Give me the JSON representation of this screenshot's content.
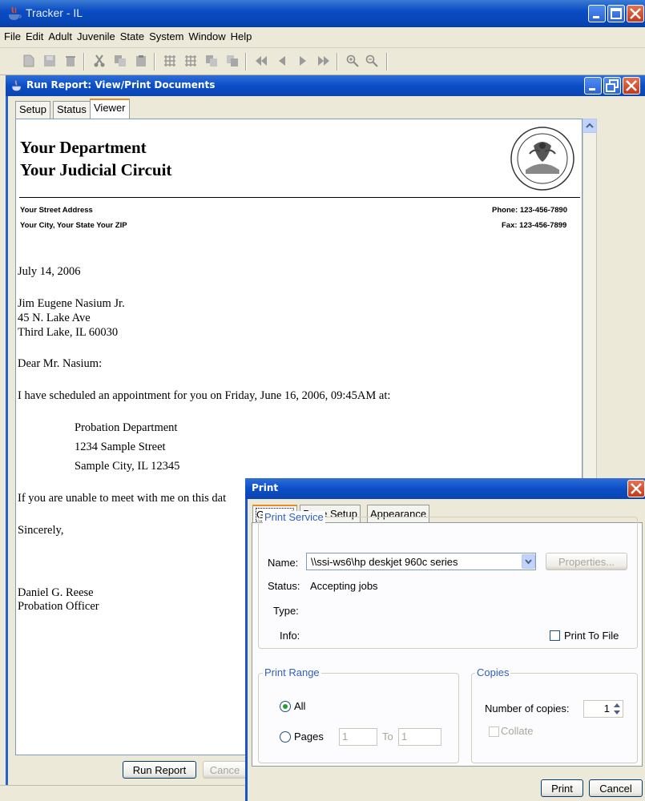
{
  "app": {
    "title": "Tracker - IL"
  },
  "menu": [
    "File",
    "Edit",
    "Adult",
    "Juvenile",
    "State",
    "System",
    "Window",
    "Help"
  ],
  "inner_window": {
    "title": "Run Report: View/Print Documents"
  },
  "tabs": [
    "Setup",
    "Status",
    "Viewer"
  ],
  "document": {
    "dept": "Your Department",
    "circuit": "Your Judicial Circuit",
    "address1": "Your Street Address",
    "address2": "Your City, Your State Your ZIP",
    "phone": "Phone: 123-456-7890",
    "fax": "Fax: 123-456-7899",
    "date": "July 14, 2006",
    "to_name": "Jim Eugene Nasium Jr.",
    "to_street": "45 N. Lake Ave",
    "to_city": "Third Lake, IL 60030",
    "salutation": "Dear Mr. Nasium:",
    "body1": "I have scheduled an appointment for you on Friday, June 16, 2006, 09:45AM at:",
    "loc1": "Probation Department",
    "loc2": "1234 Sample Street",
    "loc3": "Sample City, IL 12345",
    "body2": "If you are unable to meet with me on this dat",
    "closing": "Sincerely,",
    "signer": "Daniel G. Reese",
    "signer_title": "Probation Officer"
  },
  "buttons": {
    "run_report": "Run Report",
    "cancel": "Cance"
  },
  "print_dialog": {
    "title": "Print",
    "tabs": [
      "General",
      "Page Setup",
      "Appearance"
    ],
    "print_service": "Print Service",
    "name_label": "Name:",
    "printer": "\\\\ssi-ws6\\hp deskjet 960c series",
    "properties": "Properties...",
    "status_label": "Status:",
    "status_value": "Accepting jobs",
    "type_label": "Type:",
    "info_label": "Info:",
    "print_to_file": "Print To File",
    "print_range": "Print Range",
    "all": "All",
    "pages": "Pages",
    "from_page": "1",
    "to_label": "To",
    "to_page": "1",
    "copies": "Copies",
    "num_copies_label": "Number of copies:",
    "num_copies": "1",
    "collate": "Collate",
    "print_btn": "Print",
    "cancel_btn": "Cancel"
  },
  "colors": {
    "titlebar_blue": "#0a4cc2",
    "close_red": "#c23a1a",
    "group_label_blue": "#2f5fc1"
  }
}
